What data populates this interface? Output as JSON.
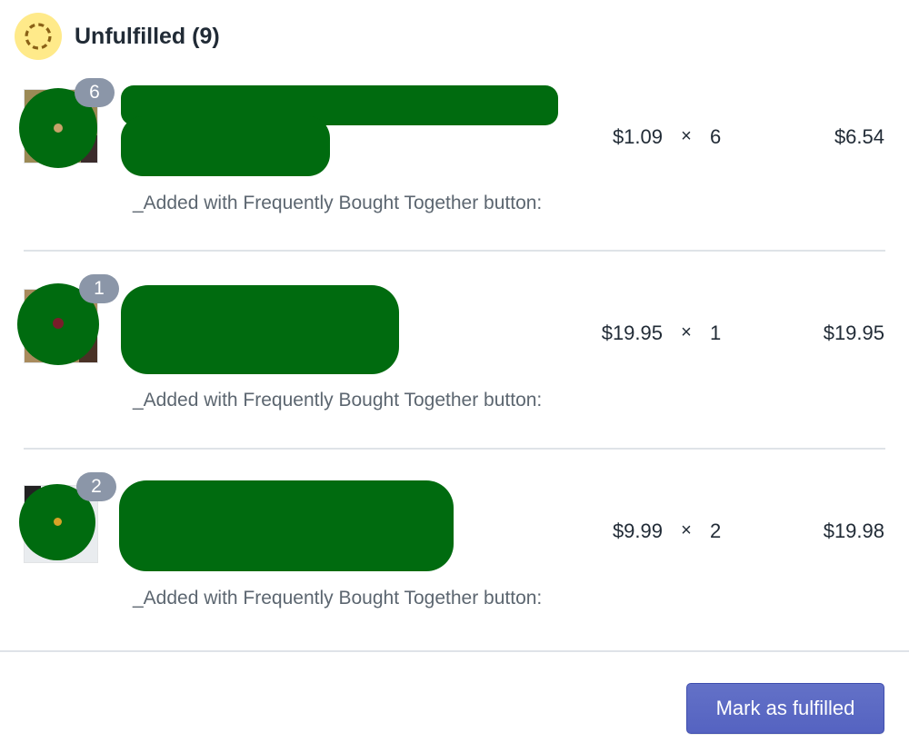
{
  "section": {
    "title": "Unfulfilled (9)",
    "status_icon": "unfulfilled-dashed-circle-icon",
    "status_color": "#ffea8a"
  },
  "line_items": [
    {
      "quantity_badge": "6",
      "unit_price": "$1.09",
      "times": "×",
      "quantity": "6",
      "total": "$6.54",
      "property": "_Added with Frequently Bought Together button:"
    },
    {
      "quantity_badge": "1",
      "unit_price": "$19.95",
      "times": "×",
      "quantity": "1",
      "total": "$19.95",
      "property": "_Added with Frequently Bought Together button:"
    },
    {
      "quantity_badge": "2",
      "unit_price": "$9.99",
      "times": "×",
      "quantity": "2",
      "total": "$19.98",
      "property": "_Added with Frequently Bought Together button:"
    }
  ],
  "footer": {
    "mark_fulfilled_label": "Mark as fulfilled",
    "button_color": "#5c6ac4"
  },
  "colors": {
    "redaction": "#006b0f",
    "badge": "#8b96a8",
    "muted_text": "#5c6670"
  }
}
